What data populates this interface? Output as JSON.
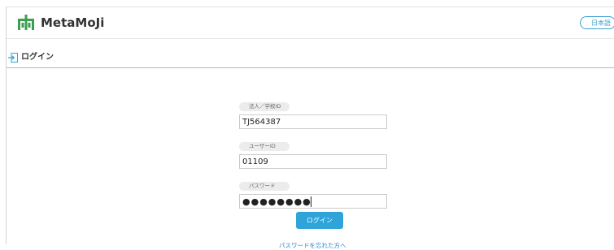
{
  "app": {
    "name": "MetaMoJi",
    "logo_icon": "metamoji-logo-icon",
    "brand_color": "#3aa04f",
    "accent_color": "#2ea4d9"
  },
  "header": {
    "language_button": "日本語"
  },
  "page": {
    "title": "ログイン",
    "title_icon": "login-icon"
  },
  "form": {
    "org_label": "法人／学校ID",
    "org_value": "TJ564387",
    "user_label": "ユーザーID",
    "user_value": "01109",
    "password_label": "パスワード",
    "password_value": "●●●●●●●●",
    "login_button": "ログイン",
    "forgot_link": "パスワードを忘れた方へ"
  }
}
